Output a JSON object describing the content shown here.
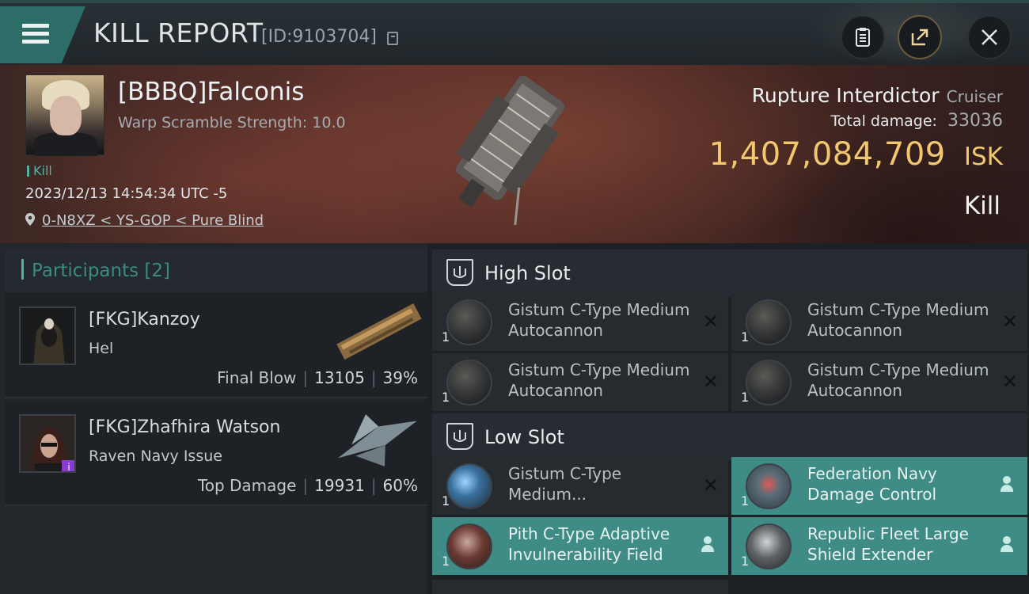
{
  "header": {
    "title": "KILL REPORT",
    "id_text": "[ID:9103704]",
    "menu_icon": "hamburger-menu-icon",
    "buttons": [
      "clipboard-icon",
      "share-icon",
      "close-icon"
    ]
  },
  "victim": {
    "name": "[BBBQ]Falconis",
    "subtitle": "Warp Scramble Strength: 10.0",
    "tag": "Kill",
    "datetime": "2023/12/13 14:54:34 UTC -5",
    "location": "0-N8XZ < YS-GOP < Pure Blind",
    "ship_name": "Rupture Interdictor",
    "ship_class": "Cruiser",
    "damage_label": "Total damage:",
    "damage_value": "33036",
    "isk_value": "1,407,084,709",
    "isk_unit": "ISK",
    "result": "Kill"
  },
  "participants": {
    "title": "Participants [2]",
    "items": [
      {
        "name": "[FKG]Kanzoy",
        "ship": "Hel",
        "stat_label": "Final Blow",
        "damage": "13105",
        "percent": "39%"
      },
      {
        "name": "[FKG]Zhafhira Watson",
        "ship": "Raven Navy Issue",
        "stat_label": "Top Damage",
        "damage": "19931",
        "percent": "60%",
        "badge": "i"
      }
    ]
  },
  "fitting": {
    "high_slot": {
      "title": "High Slot",
      "modules": [
        {
          "qty": "1",
          "name": "Gistum C-Type Medium Autocannon",
          "state": "destroyed"
        },
        {
          "qty": "1",
          "name": "Gistum C-Type Medium Autocannon",
          "state": "destroyed"
        },
        {
          "qty": "1",
          "name": "Gistum C-Type Medium Autocannon",
          "state": "destroyed"
        },
        {
          "qty": "1",
          "name": "Gistum C-Type Medium Autocannon",
          "state": "destroyed"
        }
      ]
    },
    "low_slot": {
      "title": "Low Slot",
      "modules": [
        {
          "qty": "1",
          "name": "Gistum C-Type Medium...",
          "state": "destroyed"
        },
        {
          "qty": "1",
          "name": "Federation Navy Damage Control",
          "state": "dropped"
        },
        {
          "qty": "1",
          "name": "Pith C-Type Adaptive Invulnerability Field",
          "state": "dropped"
        },
        {
          "qty": "1",
          "name": "Republic Fleet Large Shield Extender",
          "state": "dropped"
        }
      ]
    },
    "destroyed_mark": "✕"
  },
  "colors": {
    "accent_teal": "#4fb4a4",
    "active_row": "#3e8c85",
    "isk_gold": "#f1c86f"
  }
}
